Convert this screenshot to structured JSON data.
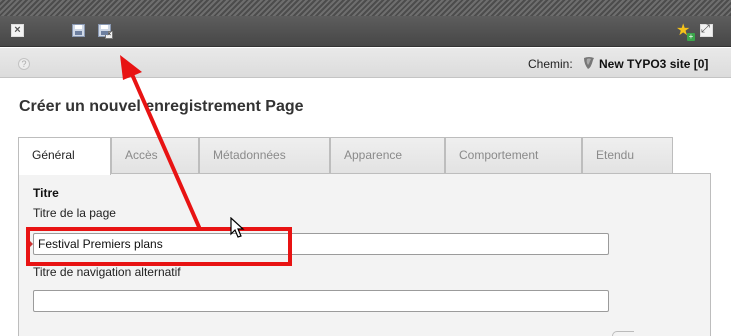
{
  "toolbar": {
    "buttons": [
      {
        "name": "close",
        "icon": "close-icon"
      },
      {
        "name": "save",
        "icon": "save-icon"
      },
      {
        "name": "save-and-close",
        "icon": "save-close-icon"
      },
      {
        "name": "add-bookmark",
        "icon": "star-add-icon"
      },
      {
        "name": "open-new-window",
        "icon": "expand-window-icon"
      }
    ]
  },
  "pathbar": {
    "label": "Chemin:",
    "value": "New TYPO3 site [0]"
  },
  "page": {
    "title": "Créer un nouvel enregistrement Page"
  },
  "tabs": [
    {
      "label": "Général",
      "active": true
    },
    {
      "label": "Accès",
      "active": false
    },
    {
      "label": "Métadonnées",
      "active": false
    },
    {
      "label": "Apparence",
      "active": false
    },
    {
      "label": "Comportement",
      "active": false
    },
    {
      "label": "Etendu",
      "active": false
    }
  ],
  "form": {
    "section_title": "Titre",
    "page_title_label": "Titre de la page",
    "page_title_value": "Festival Premiers plans",
    "nav_title_label": "Titre de navigation alternatif",
    "nav_title_value": ""
  },
  "colors": {
    "annotation_red": "#e81313",
    "toolbar_dark": "#4f4f4f"
  }
}
